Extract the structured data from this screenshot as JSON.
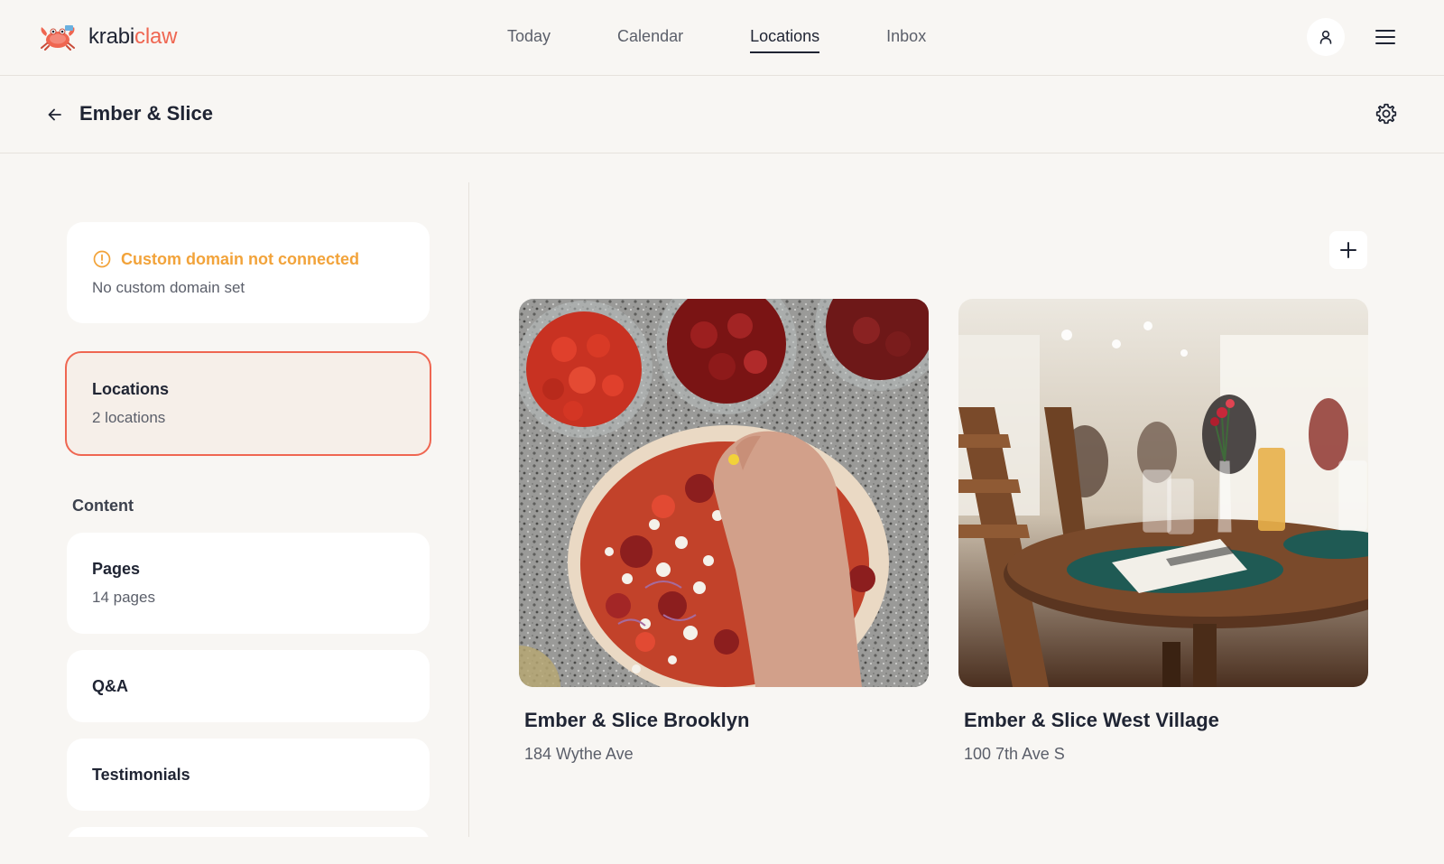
{
  "brand": {
    "name_part1": "krabi",
    "name_part2": "claw",
    "accent": "#ef6651",
    "logo_icon": "crab-icon"
  },
  "nav": {
    "items": [
      {
        "label": "Today",
        "active": false
      },
      {
        "label": "Calendar",
        "active": false
      },
      {
        "label": "Locations",
        "active": true
      },
      {
        "label": "Inbox",
        "active": false
      }
    ],
    "user_icon": "user-icon",
    "menu_icon": "hamburger-menu-icon"
  },
  "header": {
    "title": "Ember & Slice",
    "back_icon": "arrow-left-icon",
    "settings_icon": "gear-icon"
  },
  "sidebar": {
    "domain_card": {
      "title": "Custom domain not connected",
      "subtitle": "No custom domain set",
      "status_color": "#f2a33a",
      "icon": "alert-circle-icon"
    },
    "locations_card": {
      "title": "Locations",
      "subtitle": "2 locations",
      "selected": true
    },
    "content_label": "Content",
    "pages_card": {
      "title": "Pages",
      "subtitle": "14 pages"
    },
    "qa_card": {
      "title": "Q&A"
    },
    "testimonials_card": {
      "title": "Testimonials"
    }
  },
  "main": {
    "add_icon": "plus-icon",
    "locations": [
      {
        "name": "Ember & Slice Brooklyn",
        "address": "184 Wythe Ave"
      },
      {
        "name": "Ember & Slice West Village",
        "address": "100 7th Ave S"
      }
    ]
  }
}
